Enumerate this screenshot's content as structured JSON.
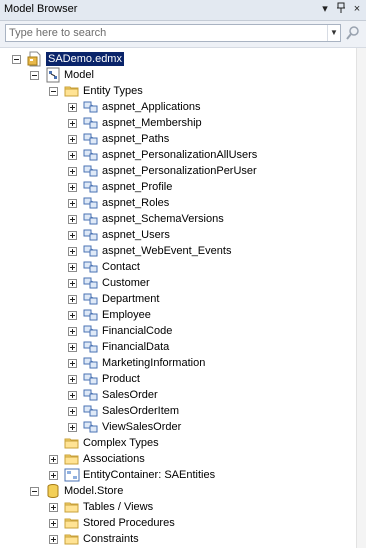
{
  "panel": {
    "title": "Model Browser",
    "pin_glyph": "▾",
    "pin2_glyph": "ᵖ",
    "close_glyph": "×"
  },
  "search": {
    "placeholder": "Type here to search",
    "value": ""
  },
  "tree": {
    "root": {
      "label": "SADemo.edmx"
    },
    "model": {
      "label": "Model"
    },
    "entity_types": {
      "label": "Entity Types"
    },
    "entities": [
      "aspnet_Applications",
      "aspnet_Membership",
      "aspnet_Paths",
      "aspnet_PersonalizationAllUsers",
      "aspnet_PersonalizationPerUser",
      "aspnet_Profile",
      "aspnet_Roles",
      "aspnet_SchemaVersions",
      "aspnet_Users",
      "aspnet_WebEvent_Events",
      "Contact",
      "Customer",
      "Department",
      "Employee",
      "FinancialCode",
      "FinancialData",
      "MarketingInformation",
      "Product",
      "SalesOrder",
      "SalesOrderItem",
      "ViewSalesOrder"
    ],
    "complex_types": {
      "label": "Complex Types"
    },
    "associations": {
      "label": "Associations"
    },
    "entity_container": {
      "label": "EntityContainer: SAEntities"
    },
    "model_store": {
      "label": "Model.Store"
    },
    "store_children": [
      "Tables / Views",
      "Stored Procedures",
      "Constraints"
    ]
  }
}
